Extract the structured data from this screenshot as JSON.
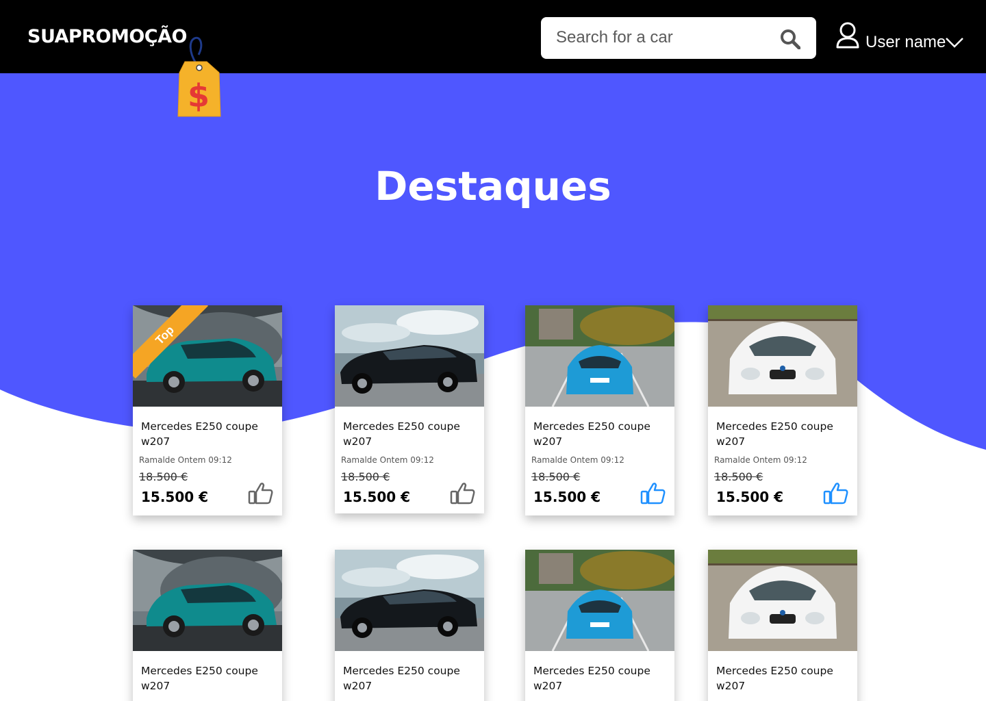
{
  "header": {
    "logo": "SUAPROMOÇÃO",
    "search_placeholder": "Search for a car",
    "user_name": "User name"
  },
  "hero": {
    "title": "Destaques"
  },
  "colors": {
    "hero_blue": "#4f57ff",
    "ribbon": "#f5a524",
    "like_active": "#1e90ff",
    "like_inactive": "#666666"
  },
  "cards": [
    {
      "title": "Mercedes E250 coupe w207",
      "meta": "Ramalde Ontem 09:12",
      "old_price": "18.500 €",
      "price": "15.500 €",
      "badge": "Top",
      "liked": false,
      "image": "teal-suv"
    },
    {
      "title": "Mercedes E250 coupe w207",
      "meta": "Ramalde Ontem 09:12",
      "old_price": "18.500 €",
      "price": "15.500 €",
      "liked": false,
      "image": "black-sedan"
    },
    {
      "title": "Mercedes E250 coupe w207",
      "meta": "Ramalde Ontem 09:12",
      "old_price": "18.500 €",
      "price": "15.500 €",
      "liked": true,
      "image": "blue-coupe"
    },
    {
      "title": "Mercedes E250 coupe w207",
      "meta": "Ramalde Ontem 09:12",
      "old_price": "18.500 €",
      "price": "15.500 €",
      "liked": true,
      "image": "white-bmw"
    },
    {
      "title": "Mercedes E250 coupe w207",
      "image": "teal-suv"
    },
    {
      "title": "Mercedes E250 coupe w207",
      "image": "black-sedan"
    },
    {
      "title": "Mercedes E250 coupe w207",
      "image": "blue-coupe"
    },
    {
      "title": "Mercedes E250 coupe w207",
      "image": "white-bmw"
    }
  ]
}
